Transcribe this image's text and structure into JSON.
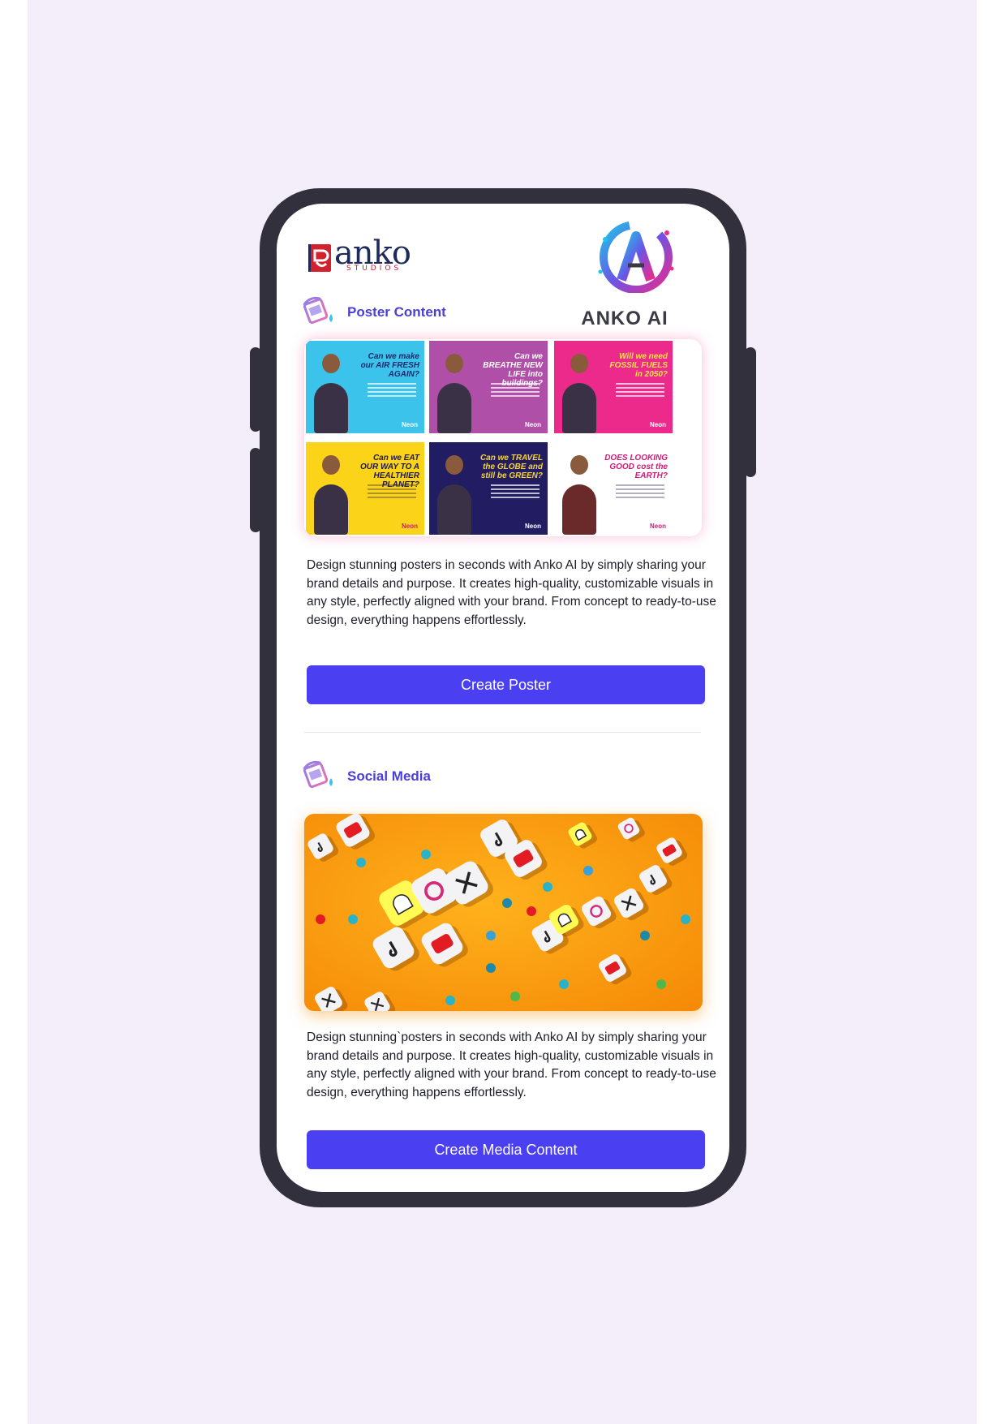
{
  "brand": {
    "studio_name": "anko",
    "studio_sub": "STUDIOS",
    "ai_name": "ANKO AI"
  },
  "sections": [
    {
      "title": "Poster Content",
      "description": "Design stunning posters in seconds with Anko AI by simply sharing your brand details and purpose. It creates high-quality, customizable visuals in any style, perfectly aligned with your brand. From concept to ready-to-use design, everything happens effortlessly.",
      "button": "Create Poster"
    },
    {
      "title": "Social Media",
      "description": "Design stunning`posters in seconds with Anko AI by simply sharing your brand details and purpose. It creates high-quality, customizable visuals in any style, perfectly aligned with your brand. From concept to ready-to-use design, everything happens effortlessly.",
      "button": "Create Media Content"
    }
  ],
  "posters": [
    {
      "headline": "Can we make our AIR FRESH AGAIN?",
      "bg": "#3cc3ec",
      "accent": "#1a2a6a",
      "brand": "Neon"
    },
    {
      "headline": "Can we BREATHE NEW LIFE into buildings?",
      "bg": "#b04fa8",
      "accent": "#ffffff",
      "brand": "Neon"
    },
    {
      "headline": "Will we need FOSSIL FUELS in 2050?",
      "bg": "#ec2a8b",
      "accent": "#ffe14a",
      "brand": "Neon"
    },
    {
      "headline": "Can we EAT OUR WAY TO A HEALTHIER PLANET?",
      "bg": "#fbd318",
      "accent": "#1d1a4a",
      "brand": "Neon"
    },
    {
      "headline": "Can we TRAVEL the GLOBE and still be GREEN?",
      "bg": "#221c63",
      "accent": "#f7d431",
      "brand": "Neon"
    },
    {
      "headline": "DOES LOOKING GOOD cost the EARTH?",
      "bg": "#ffffff",
      "accent": "#d01a78",
      "brand": "Neon"
    }
  ],
  "colors": {
    "accent": "#4a3ff1",
    "section_title": "#4a3fd8",
    "phone_frame": "#31303c",
    "page_background": "#f3eef9"
  }
}
